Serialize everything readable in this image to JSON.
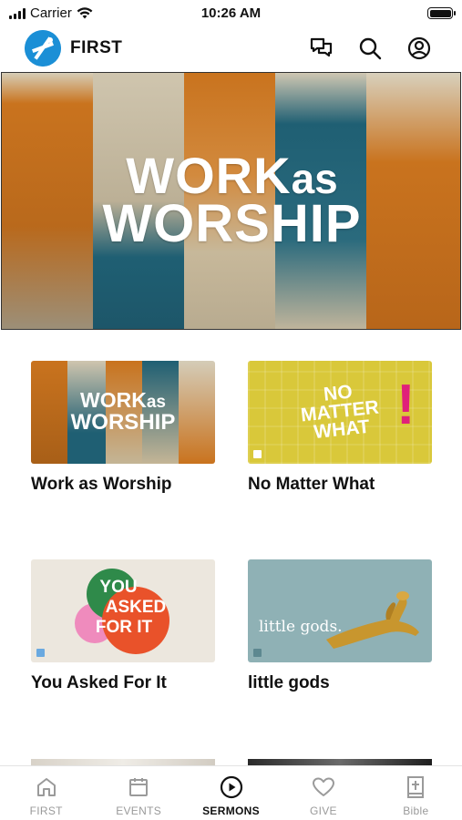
{
  "status_bar": {
    "carrier": "Carrier",
    "time": "10:26 AM"
  },
  "header": {
    "title": "FIRST",
    "icons": [
      "chat-bubbles-icon",
      "search-icon",
      "profile-icon"
    ]
  },
  "hero": {
    "line1_main": "WORK",
    "line1_small": "as",
    "line2": "WORSHIP"
  },
  "series": [
    {
      "title": "Work as Worship",
      "art_line1": "WORK",
      "art_line1_small": "as",
      "art_line2": "WORSHIP"
    },
    {
      "title": "No Matter What",
      "art_line1": "NO",
      "art_line2": "MATTER",
      "art_line3": "WHAT",
      "art_mark": "!"
    },
    {
      "title": "You Asked For It",
      "art_line1": "YOU",
      "art_line2": "ASKED",
      "art_line3": "FOR IT"
    },
    {
      "title": "little gods",
      "art_text": "little gods."
    }
  ],
  "tabs": [
    {
      "label": "FIRST",
      "icon": "home-icon",
      "active": false
    },
    {
      "label": "EVENTS",
      "icon": "calendar-icon",
      "active": false
    },
    {
      "label": "SERMONS",
      "icon": "play-circle-icon",
      "active": true
    },
    {
      "label": "GIVE",
      "icon": "heart-icon",
      "active": false
    },
    {
      "label": "Bible",
      "icon": "bible-icon",
      "active": false
    }
  ],
  "colors": {
    "orange": "#c9731e",
    "teal": "#1f5f73",
    "sepia": "#cbbfa4",
    "yellow": "#d9c83a",
    "pink_accent": "#e0217a",
    "cream": "#ece7de",
    "green": "#2f8a4a",
    "red_orange": "#e9522a",
    "pink": "#ef8bbd",
    "blue_gray": "#8fb1b5",
    "gold": "#c8962e",
    "logo_blue": "#1b8fd6"
  }
}
